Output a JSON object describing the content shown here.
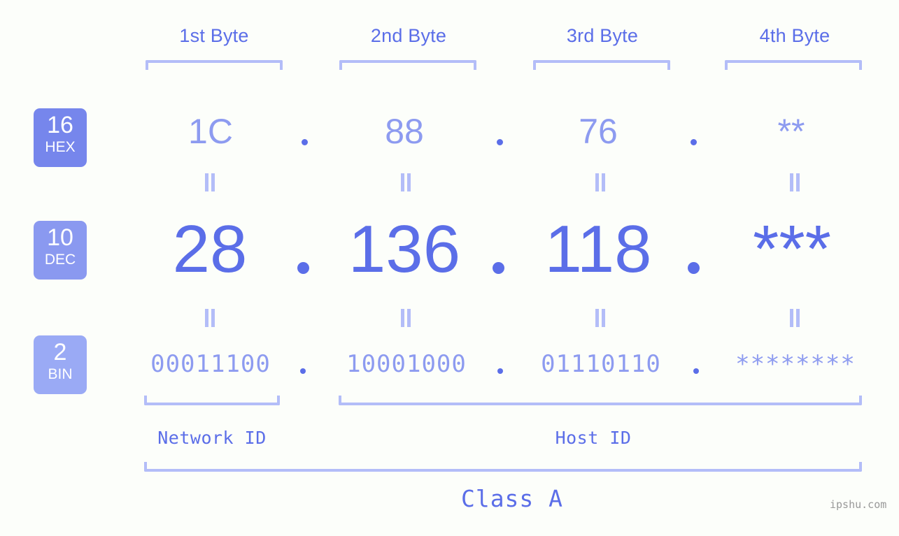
{
  "background_color": "#fcfefa",
  "colors": {
    "accent_dark": "#5b6ee8",
    "accent_light": "#8d9bf0",
    "bracket": "#b3bdf8",
    "badge_hex": "#7686ec",
    "badge_dec": "#8a99f0",
    "badge_bin": "#9aaaf5",
    "watermark": "#999999"
  },
  "byte_headers": [
    {
      "label": "1st Byte"
    },
    {
      "label": "2nd Byte"
    },
    {
      "label": "3rd Byte"
    },
    {
      "label": "4th Byte"
    }
  ],
  "bases": [
    {
      "number": "16",
      "name": "HEX"
    },
    {
      "number": "10",
      "name": "DEC"
    },
    {
      "number": "2",
      "name": "BIN"
    }
  ],
  "rows": {
    "hex": {
      "values": [
        "1C",
        "88",
        "76",
        "**"
      ],
      "separator": "."
    },
    "dec": {
      "values": [
        "28",
        "136",
        "118",
        "***"
      ],
      "separator": "."
    },
    "bin": {
      "values": [
        "00011100",
        "10001000",
        "01110110",
        "********"
      ],
      "separator": "."
    }
  },
  "equals_marks": {
    "symbol": "=",
    "count_per_row": 4,
    "rows": 2
  },
  "sections": [
    {
      "label": "Network ID"
    },
    {
      "label": "Host ID"
    }
  ],
  "class_label": "Class A",
  "watermark": "ipshu.com"
}
